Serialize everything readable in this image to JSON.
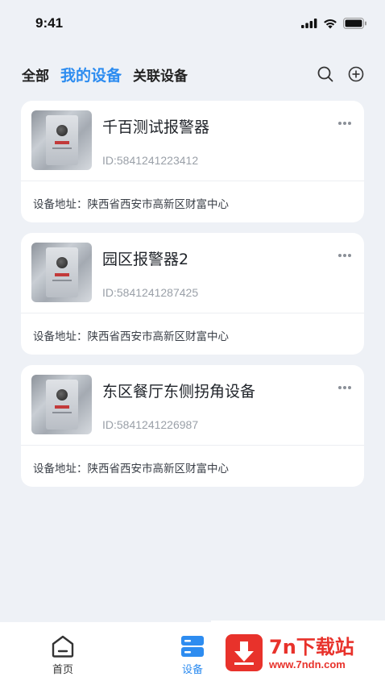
{
  "status_bar": {
    "time": "9:41"
  },
  "tabs": [
    {
      "label": "全部",
      "active": false
    },
    {
      "label": "我的设备",
      "active": true
    },
    {
      "label": "关联设备",
      "active": false
    }
  ],
  "top_icons": [
    "search-icon",
    "add-circle-icon"
  ],
  "devices": [
    {
      "name": "千百测试报警器",
      "id": "ID:5841241223412",
      "address_label": "设备地址：",
      "address": "陕西省西安市高新区财富中心"
    },
    {
      "name": "园区报警器2",
      "id": "ID:5841241287425",
      "address_label": "设备地址：",
      "address": "陕西省西安市高新区财富中心"
    },
    {
      "name": "东区餐厅东侧拐角设备",
      "id": "ID:5841241226987",
      "address_label": "设备地址：",
      "address": "陕西省西安市高新区财富中心"
    }
  ],
  "tab_bar": {
    "home_label": "首页",
    "devices_label": "设备"
  },
  "watermark": {
    "title": "7n下载站",
    "url": "www.7ndn.com"
  },
  "colors": {
    "accent": "#2d8cf0",
    "background": "#eef1f6",
    "watermark": "#e8322b"
  }
}
